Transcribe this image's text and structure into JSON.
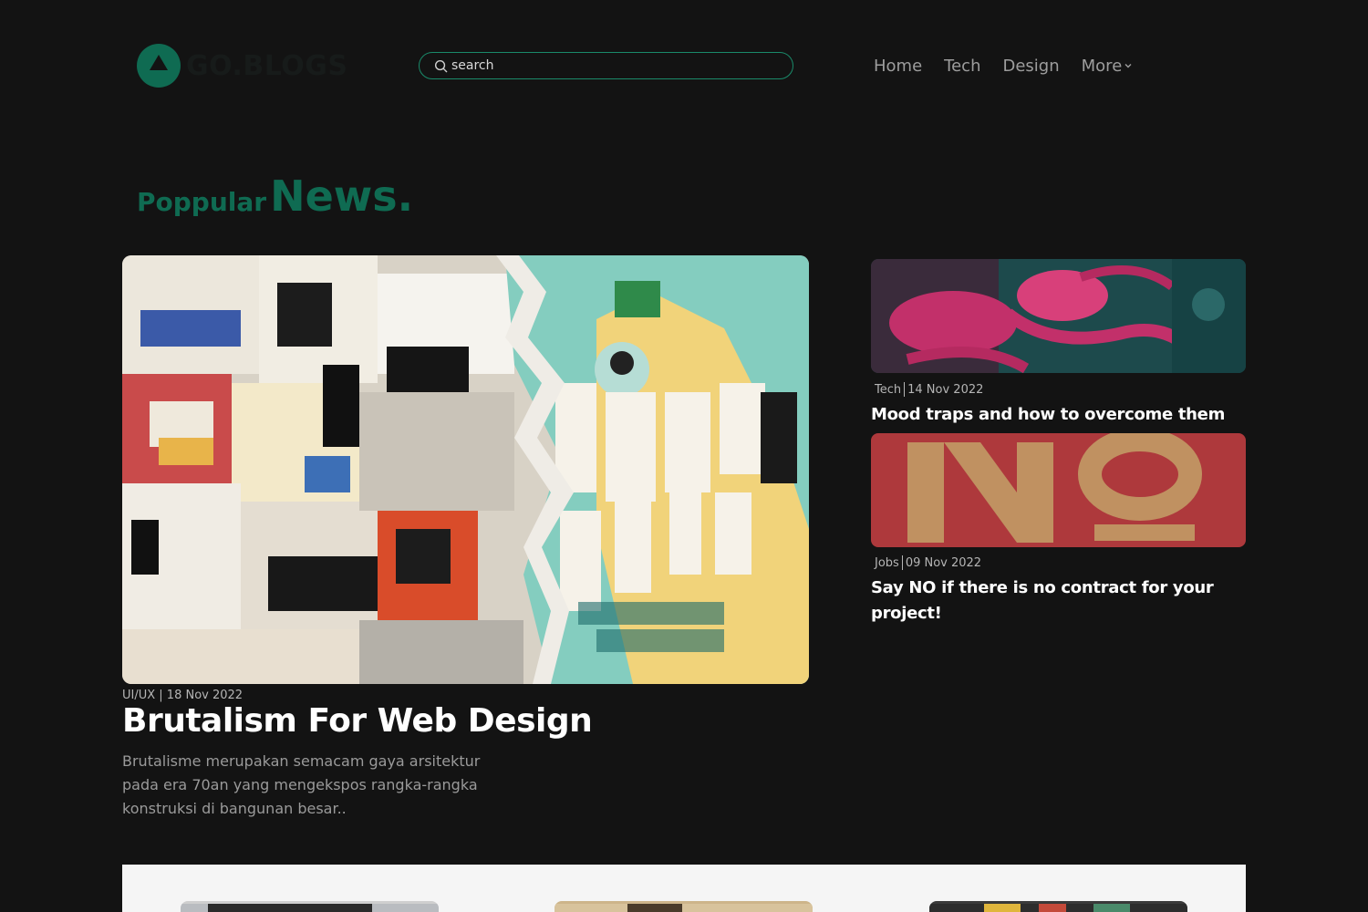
{
  "header": {
    "logo_text": "GO.BLOGS",
    "search_placeholder": "search",
    "nav": [
      {
        "label": "Home"
      },
      {
        "label": "Tech"
      },
      {
        "label": "Design"
      }
    ],
    "more_label": "More"
  },
  "section": {
    "title_small": "Poppular",
    "title_big": "News."
  },
  "featured": {
    "meta": "UI/UX | 18 Nov 2022",
    "title": "Brutalism For Web Design",
    "excerpt": "Brutalisme merupakan semacam gaya arsitektur pada era 70an yang mengekspos rangka-rangka konstruksi di bangunan besar.."
  },
  "side_posts": [
    {
      "category": "Tech",
      "date": "14 Nov 2022",
      "title": "Mood traps and how to overcome them"
    },
    {
      "category": "Jobs",
      "date": "09 Nov 2022",
      "title": "Say NO if there is no contract for your project!"
    }
  ],
  "colors": {
    "accent": "#0f6b52",
    "background": "#131313",
    "panel": "#f5f5f5"
  }
}
